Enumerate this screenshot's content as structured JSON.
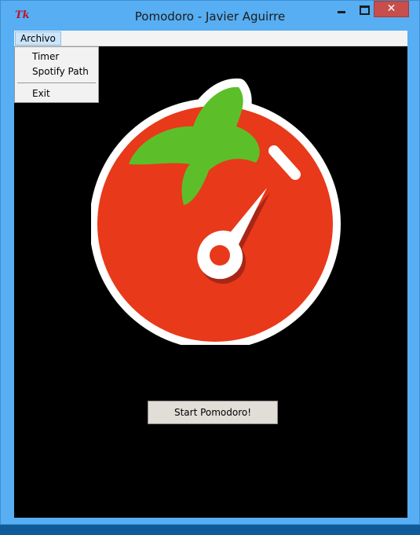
{
  "window": {
    "title": "Pomodoro - Javier Aguirre",
    "app_icon": "Tk",
    "close_glyph": "✕"
  },
  "menubar": {
    "archivo_label": "Archivo",
    "items": [
      "Timer",
      "Spotify Path",
      "Exit"
    ]
  },
  "main": {
    "start_button_label": "Start Pomodoro!",
    "logo_icon": "tomato-timer-icon"
  },
  "colors": {
    "tomato_red": "#e8391a",
    "leaf_green": "#5cbf2a",
    "window_frame": "#57aef2",
    "close_red": "#c74e4b",
    "background": "#000000"
  }
}
